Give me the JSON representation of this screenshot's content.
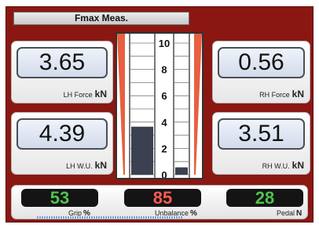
{
  "header": {
    "title": "Fmax Meas."
  },
  "readouts": {
    "lh_force": {
      "value": "3.65",
      "label": "LH Force",
      "unit": "kN"
    },
    "rh_force": {
      "value": "0.56",
      "label": "RH Force",
      "unit": "kN"
    },
    "lh_wu": {
      "value": "4.39",
      "label": "LH W.U.",
      "unit": "kN"
    },
    "rh_wu": {
      "value": "3.51",
      "label": "RH W.U.",
      "unit": "kN"
    }
  },
  "gauge": {
    "scale_max": 10,
    "tick_labels": [
      "10",
      "8",
      "6",
      "4",
      "2",
      "0"
    ],
    "left_bar_value": 3.65,
    "right_bar_value": 0.56
  },
  "metrics": {
    "grip": {
      "value": "53",
      "label": "Grip",
      "unit": "%",
      "color": "#4fc24f"
    },
    "unbalance": {
      "value": "85",
      "label": "Unbalance",
      "unit": "%",
      "color": "#ff5a52"
    },
    "pedal": {
      "value": "28",
      "label": "Pedal",
      "unit": "N",
      "color": "#4fc24f"
    }
  },
  "colors": {
    "frame": "#8a1712",
    "bar": "#3b4150",
    "wedge": "#e86040"
  }
}
